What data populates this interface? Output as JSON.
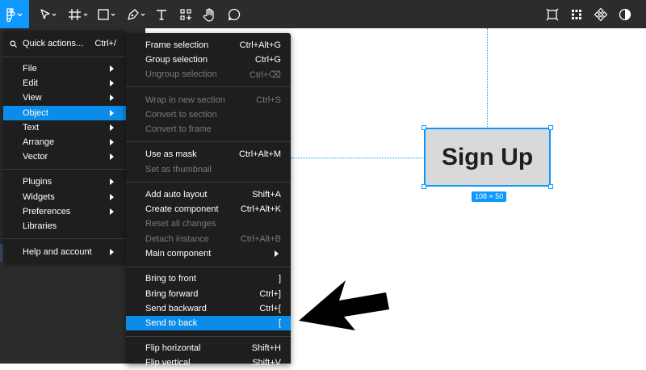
{
  "toolbar": {
    "left_tools": [
      "figma-menu-icon",
      "move-tool-icon",
      "frame-tool-icon",
      "shape-tool-icon",
      "pen-tool-icon",
      "text-tool-icon",
      "resources-icon",
      "hand-tool-icon",
      "comment-tool-icon"
    ],
    "right_tools": [
      "dev-mode-icon",
      "grid-components-icon",
      "component-icon",
      "contrast-icon"
    ],
    "accent": "#0d99ff"
  },
  "main_menu": {
    "quick_actions": {
      "label": "Quick actions...",
      "shortcut": "Ctrl+/"
    },
    "items": [
      {
        "label": "File"
      },
      {
        "label": "Edit"
      },
      {
        "label": "View"
      },
      {
        "label": "Object",
        "highlighted": true
      },
      {
        "label": "Text"
      },
      {
        "label": "Arrange"
      },
      {
        "label": "Vector"
      },
      {
        "label": "Plugins"
      },
      {
        "label": "Widgets"
      },
      {
        "label": "Preferences"
      },
      {
        "label": "Libraries"
      },
      {
        "label": "Help and account"
      }
    ]
  },
  "object_menu": {
    "items": [
      {
        "label": "Frame selection",
        "shortcut": "Ctrl+Alt+G",
        "enabled": true
      },
      {
        "label": "Group selection",
        "shortcut": "Ctrl+G",
        "enabled": true
      },
      {
        "label": "Ungroup selection",
        "shortcut": "Ctrl+⌫",
        "enabled": false
      },
      {
        "label": "Wrap in new section",
        "shortcut": "Ctrl+S",
        "enabled": false
      },
      {
        "label": "Convert to section",
        "shortcut": "",
        "enabled": false
      },
      {
        "label": "Convert to frame",
        "shortcut": "",
        "enabled": false
      },
      {
        "label": "Use as mask",
        "shortcut": "Ctrl+Alt+M",
        "enabled": true
      },
      {
        "label": "Set as thumbnail",
        "shortcut": "",
        "enabled": false
      },
      {
        "label": "Add auto layout",
        "shortcut": "Shift+A",
        "enabled": true
      },
      {
        "label": "Create component",
        "shortcut": "Ctrl+Alt+K",
        "enabled": true
      },
      {
        "label": "Reset all changes",
        "shortcut": "",
        "enabled": false
      },
      {
        "label": "Detach instance",
        "shortcut": "Ctrl+Alt+B",
        "enabled": false
      },
      {
        "label": "Main component",
        "shortcut": "",
        "enabled": true
      },
      {
        "label": "Bring to front",
        "shortcut": "]",
        "enabled": true
      },
      {
        "label": "Bring forward",
        "shortcut": "Ctrl+]",
        "enabled": true
      },
      {
        "label": "Send backward",
        "shortcut": "Ctrl+[",
        "enabled": true
      },
      {
        "label": "Send to back",
        "shortcut": "[",
        "enabled": true,
        "highlighted": true
      },
      {
        "label": "Flip horizontal",
        "shortcut": "Shift+H",
        "enabled": true
      },
      {
        "label": "Flip vertical",
        "shortcut": "Shift+V",
        "enabled": true
      }
    ]
  },
  "canvas": {
    "button_text": "Sign Up",
    "size_badge": "108 × 50",
    "frame_fill": "#d9d9d9"
  }
}
